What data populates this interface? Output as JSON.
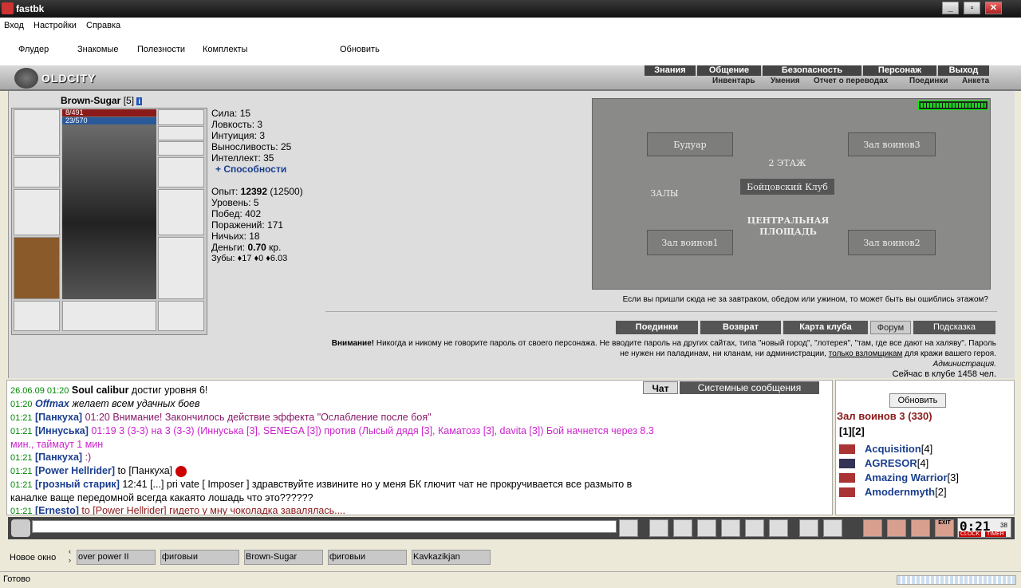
{
  "app": {
    "title": "fastbk"
  },
  "menu": [
    "Вход",
    "Настройки",
    "Справка"
  ],
  "toolbar": {
    "items": [
      "Флудер",
      "Знакомые",
      "Полезности",
      "Комплекты"
    ],
    "refresh": "Обновить"
  },
  "game": {
    "logo": "OLDCITY",
    "nav_top": [
      "Знания",
      "Общение",
      "Безопасность",
      "Персонаж",
      "Выход"
    ],
    "nav_sub": [
      "Инвентарь",
      "Умения",
      "Отчет о переводах",
      "Поединки",
      "Анкета"
    ]
  },
  "character": {
    "name": "Brown-Sugar",
    "level": "[5]",
    "hp": "8/491",
    "mana": "23/570",
    "stats": {
      "strength": "Сила: 15",
      "agility": "Ловкость: 3",
      "intuition": "Интуиция: 3",
      "endurance": "Выносливость: 25",
      "intellect": "Интеллект: 35",
      "abilities": "+ Способности"
    },
    "exp_label": "Опыт:",
    "exp_value": "12392",
    "exp_next": "(12500)",
    "level_line": "Уровень: 5",
    "wins": "Побед: 402",
    "losses": "Поражений: 171",
    "draws": "Ничьих: 18",
    "money_label": "Деньги:",
    "money_value": "0.70",
    "money_unit": "кр.",
    "teeth": "Зубы: ♦17 ♦0 ♦6.03"
  },
  "map": {
    "rooms": [
      "Будуар",
      "Зал воинов3",
      "2 ЭТАЖ",
      "Бойцовский Клуб",
      "ЗАЛЫ",
      "ЦЕНТРАЛЬНАЯ ПЛОЩАДЬ",
      "Зал воинов1",
      "Зал воинов2"
    ],
    "caption": "Если вы пришли сюда не за завтраком, обедом или ужином, то может быть вы ошиблись этажом?"
  },
  "game_buttons": [
    "Поединки",
    "Возврат",
    "Карта клуба",
    "Форум",
    "Подсказка"
  ],
  "warning": {
    "bold": "Внимание!",
    "text1": " Никогда и никому не говорите пароль от своего персонажа. Не вводите пароль на других сайтах, типа \"новый город\", \"лотерея\", \"там, где все дают на халяву\". Пароль не нужен ни паладинам, ни кланам, ни администрации, ",
    "underlined": "только взломщикам",
    "text2": " для кражи вашего героя.",
    "admin": "Администрация.",
    "online": "Сейчас в клубе 1458 чел."
  },
  "chat": {
    "tabs": [
      "Чат",
      "Системные сообщения"
    ],
    "lines": [
      {
        "time": "26.06.09 01:20",
        "name": "Soul calibur",
        "text": " достиг уровня 6!"
      },
      {
        "time": "01:20",
        "name": "Offmax",
        "text": " желает всем удачных боев"
      },
      {
        "time": "01:21",
        "name": "[Панкуха]",
        "text": " 01:20 Внимание! Закончилось действие эффекта \"Ослабление после боя\""
      },
      {
        "time": "01:21",
        "name": "[Иннуська]",
        "text": " 01:19 3 (3-3) на 3 (3-3) (Иннуська [3], SENEGA [3]) против (Лысый дядя [3], Каматозз [3], davita [3]) Бой начнется через 8.3"
      },
      {
        "time": "",
        "name": "",
        "text": "мин., таймаут 1 мин"
      },
      {
        "time": "01:21",
        "name": "[Панкуха]",
        "text": " :)"
      },
      {
        "time": "01:21",
        "name": "[Power Hellrider]",
        "text": " to [Панкуха]"
      },
      {
        "time": "01:21",
        "name": "[грозный старик]",
        "text": " 12:41 [...] pri vate [ Imposer ] здравствуйте извините но у меня БК глючит чат не прокручивается все размыто в"
      },
      {
        "time": "",
        "name": "",
        "text": "каналке ваще передомной всегда какаято лошадь что это??????"
      },
      {
        "time": "01:21",
        "name": "[Ernesto]",
        "text": " to [Power Hellrider] гидето у мну чоколадка завалялась...."
      }
    ]
  },
  "side": {
    "refresh": "Обновить",
    "room": "Зал воинов 3 (330)",
    "pages": "[1][2]",
    "players": [
      {
        "name": "Acquisition",
        "lvl": "[4]"
      },
      {
        "name": "AGRESOR",
        "lvl": "[4]"
      },
      {
        "name": "Amazing Warrior",
        "lvl": "[3]"
      },
      {
        "name": "Amodernmyth",
        "lvl": "[2]"
      }
    ]
  },
  "clock": {
    "time": "0:21",
    "sec": "38",
    "clock_label": "CLOCK",
    "timer_label": "TIMER",
    "exit": "EXIT"
  },
  "windows": {
    "new": "Новое окно",
    "tabs": [
      "over power II",
      "фиговыи",
      "Brown-Sugar",
      "фиговыи",
      "Kavkazikjan"
    ]
  },
  "status": "Готово"
}
